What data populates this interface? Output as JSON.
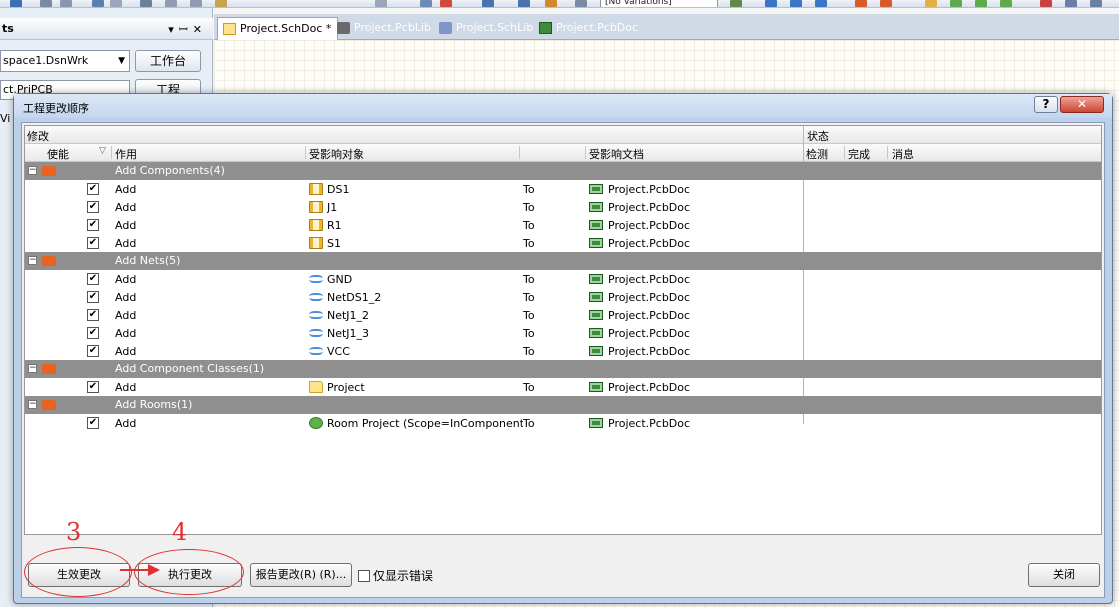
{
  "toolbar": {
    "variations": "[No Variations]"
  },
  "left_panel": {
    "title": "ts",
    "controls": [
      "▾",
      "ꟷ",
      "✕"
    ],
    "workspace": "space1.DsnWrk",
    "workspace_button": "工作台",
    "project_button": "工程",
    "project_field": "ct.PrjPCB",
    "partial_text": "Vi"
  },
  "tabs": [
    {
      "label": "Project.SchDoc *",
      "active": true
    },
    {
      "label": "Project.PcbLib",
      "active": false
    },
    {
      "label": "Project.SchLib",
      "active": false
    },
    {
      "label": "Project.PcbDoc",
      "active": false
    }
  ],
  "dialog": {
    "title": "工程更改顺序",
    "help": "?",
    "close_x": "✕",
    "group_headers": {
      "modify": "修改",
      "status": "状态"
    },
    "columns": {
      "enable": "使能",
      "action": "作用",
      "affected_object": "受影响对象",
      "affected_doc": "受影响文档",
      "check": "检测",
      "done": "完成",
      "message": "消息"
    },
    "groups": [
      {
        "name": "Add Components(4)",
        "rows": [
          {
            "action": "Add",
            "object": "DS1",
            "icon": "component-icon",
            "to": "To",
            "doc": "Project.PcbDoc"
          },
          {
            "action": "Add",
            "object": "J1",
            "icon": "component-icon",
            "to": "To",
            "doc": "Project.PcbDoc"
          },
          {
            "action": "Add",
            "object": "R1",
            "icon": "component-icon",
            "to": "To",
            "doc": "Project.PcbDoc"
          },
          {
            "action": "Add",
            "object": "S1",
            "icon": "component-icon",
            "to": "To",
            "doc": "Project.PcbDoc"
          }
        ]
      },
      {
        "name": "Add Nets(5)",
        "rows": [
          {
            "action": "Add",
            "object": "GND",
            "icon": "net-icon",
            "to": "To",
            "doc": "Project.PcbDoc"
          },
          {
            "action": "Add",
            "object": "NetDS1_2",
            "icon": "net-icon",
            "to": "To",
            "doc": "Project.PcbDoc"
          },
          {
            "action": "Add",
            "object": "NetJ1_2",
            "icon": "net-icon",
            "to": "To",
            "doc": "Project.PcbDoc"
          },
          {
            "action": "Add",
            "object": "NetJ1_3",
            "icon": "net-icon",
            "to": "To",
            "doc": "Project.PcbDoc"
          },
          {
            "action": "Add",
            "object": "VCC",
            "icon": "net-icon",
            "to": "To",
            "doc": "Project.PcbDoc"
          }
        ]
      },
      {
        "name": "Add Component Classes(1)",
        "rows": [
          {
            "action": "Add",
            "object": "Project",
            "icon": "folder-icon",
            "to": "To",
            "doc": "Project.PcbDoc"
          }
        ]
      },
      {
        "name": "Add Rooms(1)",
        "rows": [
          {
            "action": "Add",
            "object": "Room Project (Scope=InComponentCl",
            "icon": "room-icon",
            "to": "To",
            "doc": "Project.PcbDoc"
          }
        ]
      }
    ],
    "buttons": {
      "validate": "生效更改",
      "execute": "执行更改",
      "report": "报告更改(R) (R)...",
      "close": "关闭"
    },
    "show_errors_only": "仅显示错误"
  },
  "annotations": {
    "step_a": "3",
    "step_b": "4"
  },
  "colors": {
    "group_row": "#8f8f8f",
    "annotation": "#e03030",
    "dialog_frame": "#bcd0ea"
  }
}
